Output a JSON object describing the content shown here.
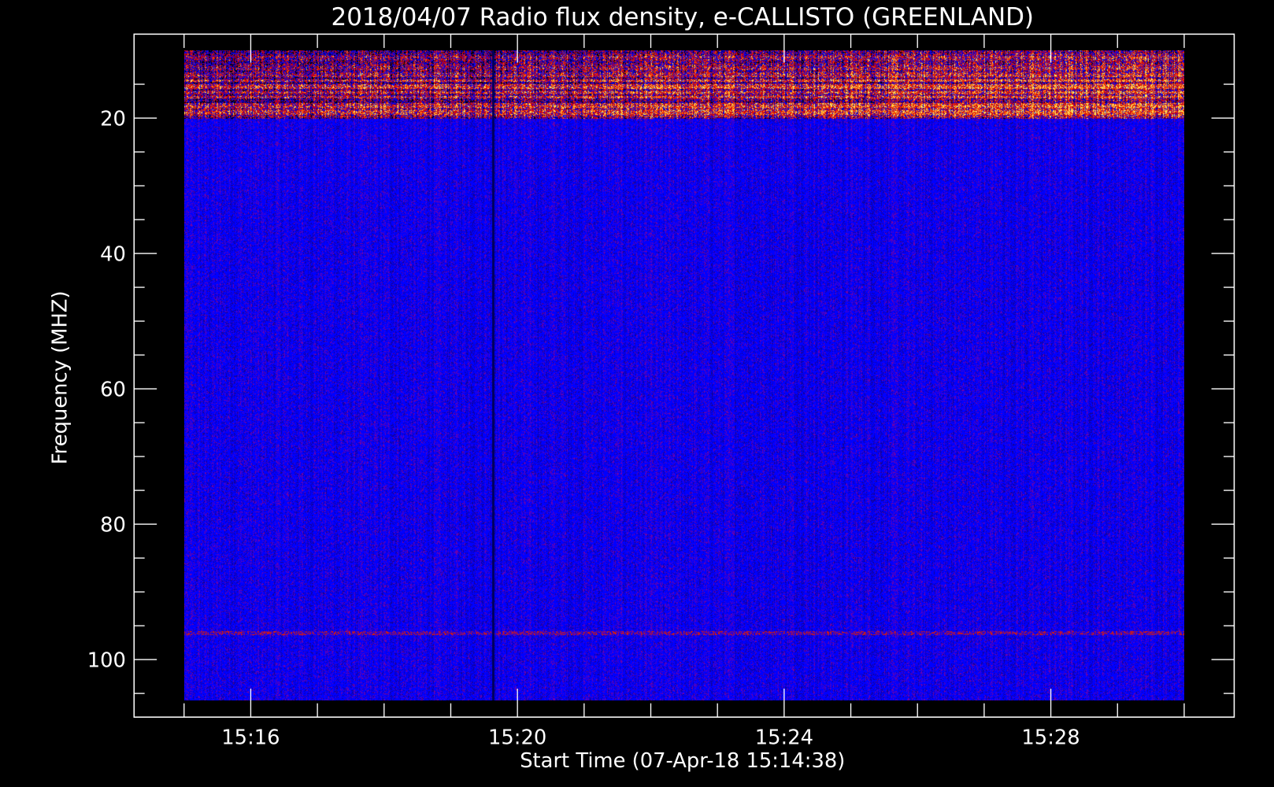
{
  "chart_data": {
    "type": "heatmap",
    "title": "2018/04/07  Radio flux density, e-CALLISTO (GREENLAND)",
    "xlabel": "Start Time (07-Apr-18 15:14:38)",
    "ylabel": "Frequency (MHZ)",
    "x_unit": "minutes after 15:00",
    "xlim": [
      14.25,
      30.75
    ],
    "data_x_range": [
      15.0,
      30.0
    ],
    "ylim": [
      108.5,
      7.6
    ],
    "data_y_range": [
      10,
      106
    ],
    "xticks": [
      {
        "value": 16,
        "label": "15:16"
      },
      {
        "value": 20,
        "label": "15:20"
      },
      {
        "value": 24,
        "label": "15:24"
      },
      {
        "value": 28,
        "label": "15:28"
      }
    ],
    "x_minor_step": 1,
    "yticks": [
      {
        "value": 20,
        "label": "20"
      },
      {
        "value": 40,
        "label": "40"
      },
      {
        "value": 60,
        "label": "60"
      },
      {
        "value": 80,
        "label": "80"
      },
      {
        "value": 100,
        "label": "100"
      }
    ],
    "y_minor_step": 5,
    "features": {
      "interference_band_mhz": [
        10,
        20
      ],
      "background_level": "blue",
      "narrowband_line_mhz": 96,
      "dark_vertical_line_time": 19.63
    },
    "colors": {
      "background": "#000000",
      "low": "#0000ff",
      "mid": "#c00000",
      "high": "#ffff60"
    }
  }
}
